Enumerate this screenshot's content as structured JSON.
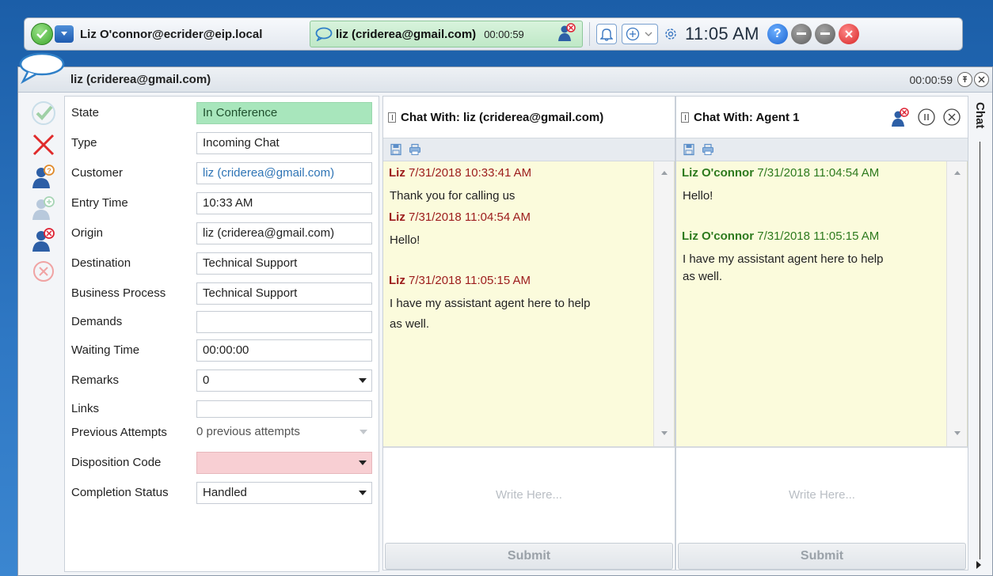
{
  "toolbar": {
    "agent": "Liz O'connor@ecrider@eip.local",
    "session_name": "liz (criderea@gmail.com)",
    "session_timer": "00:00:59",
    "clock": "11:05 AM",
    "help_label": "?"
  },
  "window": {
    "title": "liz (criderea@gmail.com)",
    "timer": "00:00:59"
  },
  "props": {
    "rows": [
      {
        "label": "State",
        "value": "In Conference"
      },
      {
        "label": "Type",
        "value": "Incoming Chat"
      },
      {
        "label": "Customer",
        "value": "liz (criderea@gmail.com)"
      },
      {
        "label": "Entry Time",
        "value": "10:33 AM"
      },
      {
        "label": "Origin",
        "value": "liz (criderea@gmail.com)"
      },
      {
        "label": "Destination",
        "value": "Technical Support"
      },
      {
        "label": "Business Process",
        "value": "Technical Support"
      },
      {
        "label": "Demands",
        "value": ""
      },
      {
        "label": "Waiting Time",
        "value": "00:00:00"
      },
      {
        "label": "Remarks",
        "value": "0"
      },
      {
        "label": "Links",
        "value": ""
      },
      {
        "label": "Previous Attempts",
        "value": "0 previous attempts"
      },
      {
        "label": "Disposition Code",
        "value": ""
      },
      {
        "label": "Completion Status",
        "value": "Handled"
      }
    ]
  },
  "chat_customer": {
    "title": "Chat With: liz (criderea@gmail.com)",
    "messages": [
      {
        "sender": "Liz",
        "time": "7/31/2018 10:33:41 AM",
        "text": "Thank you for calling us"
      },
      {
        "sender": "Liz",
        "time": "7/31/2018 11:04:54 AM",
        "text": "Hello!"
      },
      {
        "sender": "Liz",
        "time": "7/31/2018 11:05:15 AM",
        "text_l1": "I have my assistant agent here to help",
        "text_l2": "as well."
      }
    ],
    "placeholder": "Write Here...",
    "submit": "Submit"
  },
  "chat_agent": {
    "title": "Chat With: Agent 1",
    "messages": [
      {
        "sender": "Liz O'connor",
        "time": "7/31/2018 11:04:54 AM",
        "text": "Hello!"
      },
      {
        "sender": "Liz O'connor",
        "time": "7/31/2018 11:05:15 AM",
        "text_l1": "I have my assistant agent here to help",
        "text_l2": "as well."
      }
    ],
    "placeholder": "Write Here...",
    "submit": "Submit"
  },
  "rail": {
    "label": "Chat"
  },
  "colors": {
    "state_green": "#a8e6bc",
    "disposition_pink": "#f8cfd3",
    "customer_sender": "#9c1b1b",
    "agent_sender": "#2d7a1e",
    "chat_bg": "#fbfbdc"
  }
}
